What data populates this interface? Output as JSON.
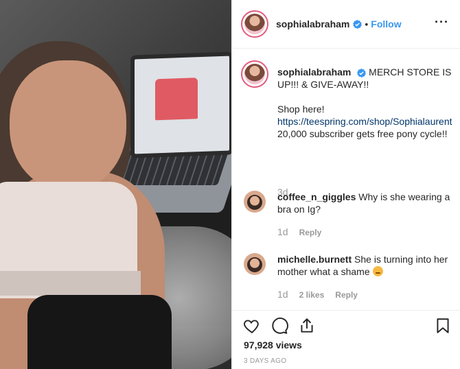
{
  "post": {
    "username": "sophialabraham",
    "follow_label": "Follow",
    "separator": "•",
    "more_label": "···"
  },
  "caption": {
    "username": "sophialabraham",
    "line1": "MERCH STORE IS UP!!! & GIVE-AWAY!!",
    "line2": "Shop here!",
    "link": "https://teespring.com/shop/Sophialaurent",
    "line3": "20,000 subscriber gets free pony cycle!!",
    "time": "3d"
  },
  "comments": [
    {
      "username": "coffee_n_giggles",
      "text": "Why is she wearing a bra on Ig?",
      "time": "1d",
      "likes": "",
      "reply_label": "Reply"
    },
    {
      "username": "michelle.burnett",
      "text": "She is turning into her mother what a shame",
      "time": "1d",
      "likes": "2 likes",
      "reply_label": "Reply"
    }
  ],
  "stats": {
    "views": "97,928 views",
    "date": "3 DAYS AGO"
  },
  "icons": {
    "like": "heart-icon",
    "comment": "comment-icon",
    "share": "share-icon",
    "save": "bookmark-icon",
    "verified": "verified-badge-icon"
  },
  "colors": {
    "link": "#003569",
    "follow": "#3897f0",
    "verified": "#3897f0",
    "muted": "#999999"
  }
}
